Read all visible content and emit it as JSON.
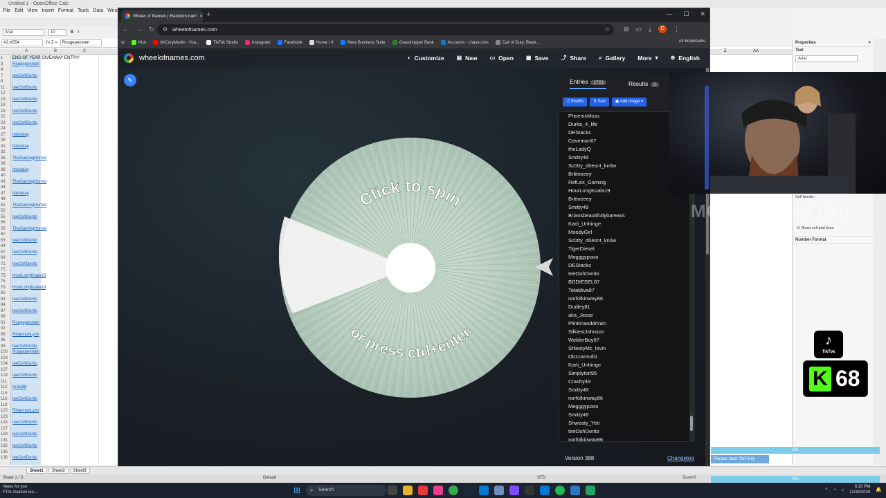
{
  "calc": {
    "title": "Untitled 1 - OpenOffice Calc",
    "menu": [
      "File",
      "Edit",
      "View",
      "Insert",
      "Format",
      "Tools",
      "Data",
      "Window"
    ],
    "font_name": "Arial",
    "font_size": "10",
    "name_box": "A3:A554",
    "formula_value": "Rougepenmen",
    "col_headers": [
      "A",
      "B",
      "C"
    ],
    "right_col_headers": [
      "Z",
      "AA"
    ],
    "rows": [
      {
        "n": "1",
        "v": "END OF YEAR GIVEAWAY ENTRY!",
        "dark": true
      },
      {
        "n": "3",
        "v": "Rougepenmen"
      },
      {
        "n": "4",
        "v": ""
      },
      {
        "n": "7",
        "v": "teeOohDorito"
      },
      {
        "n": "8",
        "v": ""
      },
      {
        "n": "11",
        "v": "teeOohDorito"
      },
      {
        "n": "12",
        "v": ""
      },
      {
        "n": "15",
        "v": "teeOohDorito"
      },
      {
        "n": "16",
        "v": ""
      },
      {
        "n": "19",
        "v": "teeOohDorito"
      },
      {
        "n": "20",
        "v": ""
      },
      {
        "n": "23",
        "v": "teeOohDorito"
      },
      {
        "n": "24",
        "v": ""
      },
      {
        "n": "27",
        "v": "itsktoday"
      },
      {
        "n": "28",
        "v": ""
      },
      {
        "n": "31",
        "v": "itsktoday"
      },
      {
        "n": "32",
        "v": ""
      },
      {
        "n": "35",
        "v": "TheGamingHornet"
      },
      {
        "n": "36",
        "v": ""
      },
      {
        "n": "39",
        "v": "itsktoday"
      },
      {
        "n": "40",
        "v": ""
      },
      {
        "n": "43",
        "v": "TheGamingHornet"
      },
      {
        "n": "44",
        "v": ""
      },
      {
        "n": "47",
        "v": "itsktoday"
      },
      {
        "n": "48",
        "v": ""
      },
      {
        "n": "51",
        "v": "TheGamingHornet"
      },
      {
        "n": "52",
        "v": ""
      },
      {
        "n": "55",
        "v": "teeOohDorito"
      },
      {
        "n": "56",
        "v": ""
      },
      {
        "n": "59",
        "v": "TheGamingHornet"
      },
      {
        "n": "60",
        "v": ""
      },
      {
        "n": "63",
        "v": "teeOohDorito"
      },
      {
        "n": "64",
        "v": ""
      },
      {
        "n": "67",
        "v": "teeOohDorito"
      },
      {
        "n": "68",
        "v": ""
      },
      {
        "n": "71",
        "v": "teeOohDorito"
      },
      {
        "n": "72",
        "v": ""
      },
      {
        "n": "75",
        "v": "HourLongKoala19"
      },
      {
        "n": "76",
        "v": ""
      },
      {
        "n": "79",
        "v": "HourLongKoala19"
      },
      {
        "n": "80",
        "v": ""
      },
      {
        "n": "83",
        "v": "teeOohDorito"
      },
      {
        "n": "84",
        "v": ""
      },
      {
        "n": "87",
        "v": "teeOohDorito"
      },
      {
        "n": "88",
        "v": ""
      },
      {
        "n": "91",
        "v": "Rougepenmen"
      },
      {
        "n": "92",
        "v": ""
      },
      {
        "n": "95",
        "v": "RhiannonLynn"
      },
      {
        "n": "96",
        "v": ""
      },
      {
        "n": "99",
        "v": "teeOohDorito"
      },
      {
        "n": "100",
        "v": "Rougepenmen"
      },
      {
        "n": "103",
        "v": ""
      },
      {
        "n": "104",
        "v": "teeOohDorito"
      },
      {
        "n": "107",
        "v": ""
      },
      {
        "n": "108",
        "v": "teeOohDorito"
      },
      {
        "n": "111",
        "v": ""
      },
      {
        "n": "112",
        "v": "Kralc88"
      },
      {
        "n": "115",
        "v": ""
      },
      {
        "n": "116",
        "v": "teeOohDorito"
      },
      {
        "n": "119",
        "v": ""
      },
      {
        "n": "120",
        "v": "RhiannonLynn"
      },
      {
        "n": "123",
        "v": ""
      },
      {
        "n": "124",
        "v": "teeOohDorito"
      },
      {
        "n": "127",
        "v": ""
      },
      {
        "n": "128",
        "v": "teeOohDorito"
      },
      {
        "n": "131",
        "v": ""
      },
      {
        "n": "132",
        "v": "teeOohDorito"
      },
      {
        "n": "135",
        "v": ""
      },
      {
        "n": "136",
        "v": "teeOohDorito"
      }
    ],
    "sheet_tabs": [
      "Sheet1",
      "Sheet2",
      "Sheet3"
    ],
    "status_sheet": "Sheet 1 / 3",
    "status_style": "Default",
    "status_mode": "STD",
    "status_sum": "Sum=0"
  },
  "properties": {
    "title": "Properties",
    "text_section": "Text",
    "font": "Arial",
    "size": "10",
    "cell_border": "Cell border:",
    "show_grid": "Show cell grid lines",
    "number_format": "Number Format"
  },
  "browser": {
    "tab_title": "Wheel of Names | Random nam",
    "url": "wheelofnames.com",
    "profile_initial": "C",
    "bookmarks": [
      {
        "label": "Kick",
        "color": "#53fc18"
      },
      {
        "label": "MrCoryMartin - You...",
        "color": "#ff0000"
      },
      {
        "label": "TikTok Studio",
        "color": "#ffffff"
      },
      {
        "label": "Instagram",
        "color": "#e1306c"
      },
      {
        "label": "Facebook",
        "color": "#1877f2"
      },
      {
        "label": "Home / X",
        "color": "#dddddd"
      },
      {
        "label": "Meta Business Suite",
        "color": "#0a7cff"
      },
      {
        "label": "Grasshopper Bank",
        "color": "#2e7d32"
      },
      {
        "label": "Accounts - chase.com",
        "color": "#117aca"
      },
      {
        "label": "Call of Duty: Black...",
        "color": "#888888"
      }
    ],
    "all_bookmarks": "All Bookmarks"
  },
  "app": {
    "site_name": "wheelofnames.com",
    "menu": [
      {
        "label": "Customize",
        "icon": "palette-icon"
      },
      {
        "label": "New",
        "icon": "file-icon"
      },
      {
        "label": "Open",
        "icon": "folder-icon"
      },
      {
        "label": "Save",
        "icon": "save-icon"
      },
      {
        "label": "Share",
        "icon": "share-icon"
      },
      {
        "label": "Gallery",
        "icon": "search-icon"
      },
      {
        "label": "More",
        "icon": "chevron-down-icon"
      },
      {
        "label": "English",
        "icon": "globe-icon"
      }
    ],
    "wheel_text_top": "Click to spin",
    "wheel_text_bottom": "or press ctrl+enter",
    "tab_entries": "Entries",
    "entries_count": "1721",
    "tab_results": "Results",
    "results_count": "0",
    "btn_shuffle": "Shuffle",
    "btn_sort": "Sort",
    "btn_add_image": "Add image",
    "entries": [
      "PhoenixMoss",
      "Durka_4_life",
      "DEStacks",
      "Caveman67",
      "theLadyQ",
      "Smitty48",
      "Sc0tty_d0esnt_kn0w",
      "Brittneeey",
      "RefLex_Gaming",
      "HourLongKoala19",
      "Brittneeey",
      "Smitty48",
      "Briansbeautifullybareass",
      "Karli_Unhinge",
      "MoodyGirl",
      "Sc0tty_d0esnt_kn0w",
      "TigerDiesel",
      "Megggypooo",
      "DEStacks",
      "teeOohDorito",
      "BDDIESEL87",
      "Totaldiva87",
      "norfolkinway86",
      "Dudley81",
      "aka_Jesse",
      "Plinkinanddrinkn",
      "SilkiestJohnson",
      "WelderBoy97",
      "ShiestyMc_lovin",
      "Ob1cannoli1",
      "Karli_Unhinge",
      "Simplytori95",
      "Crashy49",
      "Smitty48",
      "norfolkinway86",
      "Megggypooo",
      "Smitty48",
      "Shweaty_Yeti",
      "teeOohDorito",
      "norfolkinway86"
    ],
    "version": "Version 388",
    "changelog": "Changelog"
  },
  "overlays": {
    "mgm_subs": "MGM SUBS 5 / 10",
    "tiktok_label": "TikTok",
    "kick_count": "68",
    "tikfinity_pct_1": "0%",
    "tikfinity_msg": "Please start TikFinity",
    "tikfinity_pct_2": "0%",
    "tikfinity_msg_2": "Please start TikFinity"
  },
  "taskbar": {
    "weather_title": "News for you",
    "weather_sub": "FTAI Aviation lau...",
    "search": "Search",
    "time": "6:20 PM",
    "date": "12/30/2025"
  },
  "colors": {
    "accent_blue": "#2563eb",
    "wheel_fill": "#b9cfc2",
    "kick_green": "#53fc18"
  }
}
